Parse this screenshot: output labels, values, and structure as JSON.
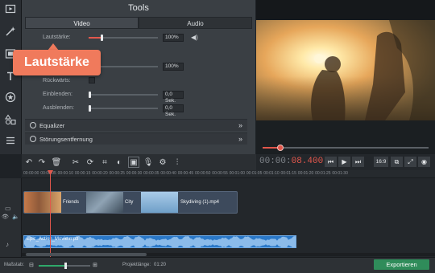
{
  "tools": {
    "title": "Tools",
    "tabs": [
      {
        "label": "Video"
      },
      {
        "label": "Audio"
      }
    ],
    "rows": {
      "volume": {
        "label": "Lautstärke:",
        "value": "100%",
        "level": 0.19
      },
      "speed": {
        "value": "100%",
        "level": 0.0
      },
      "reverse": {
        "label": "Rückwärts:"
      },
      "fade_in": {
        "label": "Einblenden:",
        "value": "0,0 Sek."
      },
      "fade_out": {
        "label": "Ausblenden:",
        "value": "0,0 Sek."
      }
    },
    "sections": [
      {
        "label": "Equalizer"
      },
      {
        "label": "Störungsentfernung"
      }
    ]
  },
  "tooltip": {
    "text": "Lautstärke"
  },
  "player": {
    "timecode_prefix": "00:00:",
    "timecode_seconds": "08.400",
    "aspect": "16:9",
    "seek_progress": 0.1
  },
  "timeline": {
    "ruler": [
      "00:00:00",
      "00:00:05",
      "00:00:10",
      "00:00:15",
      "00:00:20",
      "00:00:25",
      "00:00:30",
      "00:00:35",
      "00:00:40",
      "00:00:45",
      "00:00:50",
      "00:00:55",
      "00:01:00",
      "00:01:05",
      "00:01:10",
      "00:01:15",
      "00:01:20",
      "00:01:25",
      "00:01:30"
    ],
    "video_clips": [
      "Friends",
      "City",
      "Skydiving (1).mp4"
    ],
    "audio_clip": "Epic_Action_Movie.mp3"
  },
  "status": {
    "scale_label": "Maßstab:",
    "project_length_label": "Projektlänge:",
    "project_length": "01:20",
    "export_label": "Exportieren"
  },
  "colors": {
    "accent": "#e2574c",
    "tooltip": "#f07a5c",
    "export": "#2f8c5a"
  }
}
